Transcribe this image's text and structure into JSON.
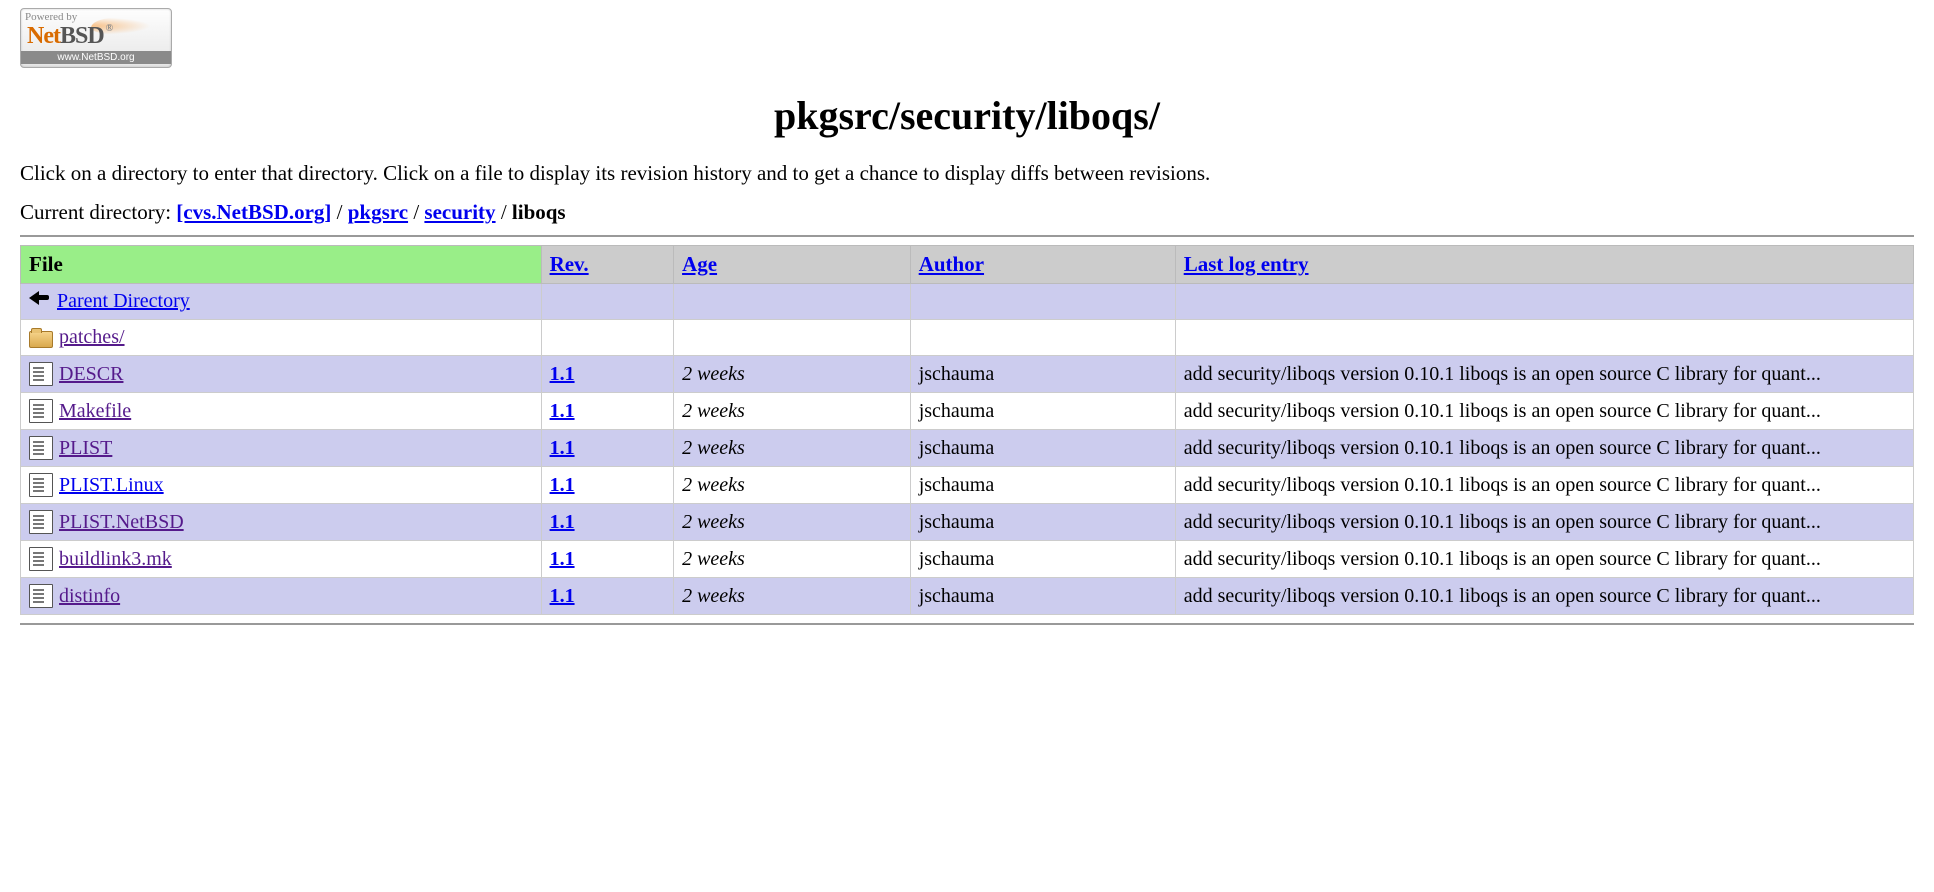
{
  "logo": {
    "powered": "Powered by",
    "net": "Net",
    "bsd": "BSD",
    "reg": "®",
    "url": "www.NetBSD.org"
  },
  "title": "pkgsrc/security/liboqs/",
  "intro": "Click on a directory to enter that directory. Click on a file to display its revision history and to get a chance to display diffs between revisions.",
  "breadcrumb": {
    "prefix": "Current directory: ",
    "root": "[cvs.NetBSD.org]",
    "sep": " / ",
    "p1": "pkgsrc",
    "p2": "security",
    "current": "liboqs"
  },
  "columns": {
    "file": "File",
    "rev": "Rev.",
    "age": "Age",
    "author": "Author",
    "log": "Last log entry"
  },
  "rows": [
    {
      "icon": "back",
      "name": "Parent Directory",
      "link_class": "",
      "rev": "",
      "age": "",
      "author": "",
      "log": ""
    },
    {
      "icon": "folder",
      "name": "patches/",
      "link_class": "visited",
      "rev": "",
      "age": "",
      "author": "",
      "log": ""
    },
    {
      "icon": "file",
      "name": "DESCR",
      "link_class": "visited",
      "rev": "1.1",
      "age": "2 weeks",
      "author": "jschauma",
      "log": "add security/liboqs version 0.10.1 liboqs is an open source C library for quant..."
    },
    {
      "icon": "file",
      "name": "Makefile",
      "link_class": "visited",
      "rev": "1.1",
      "age": "2 weeks",
      "author": "jschauma",
      "log": "add security/liboqs version 0.10.1 liboqs is an open source C library for quant..."
    },
    {
      "icon": "file",
      "name": "PLIST",
      "link_class": "visited",
      "rev": "1.1",
      "age": "2 weeks",
      "author": "jschauma",
      "log": "add security/liboqs version 0.10.1 liboqs is an open source C library for quant..."
    },
    {
      "icon": "file",
      "name": "PLIST.Linux",
      "link_class": "",
      "rev": "1.1",
      "age": "2 weeks",
      "author": "jschauma",
      "log": "add security/liboqs version 0.10.1 liboqs is an open source C library for quant..."
    },
    {
      "icon": "file",
      "name": "PLIST.NetBSD",
      "link_class": "visited",
      "rev": "1.1",
      "age": "2 weeks",
      "author": "jschauma",
      "log": "add security/liboqs version 0.10.1 liboqs is an open source C library for quant..."
    },
    {
      "icon": "file",
      "name": "buildlink3.mk",
      "link_class": "visited",
      "rev": "1.1",
      "age": "2 weeks",
      "author": "jschauma",
      "log": "add security/liboqs version 0.10.1 liboqs is an open source C library for quant..."
    },
    {
      "icon": "file",
      "name": "distinfo",
      "link_class": "visited",
      "rev": "1.1",
      "age": "2 weeks",
      "author": "jschauma",
      "log": "add security/liboqs version 0.10.1 liboqs is an open source C library for quant..."
    }
  ]
}
